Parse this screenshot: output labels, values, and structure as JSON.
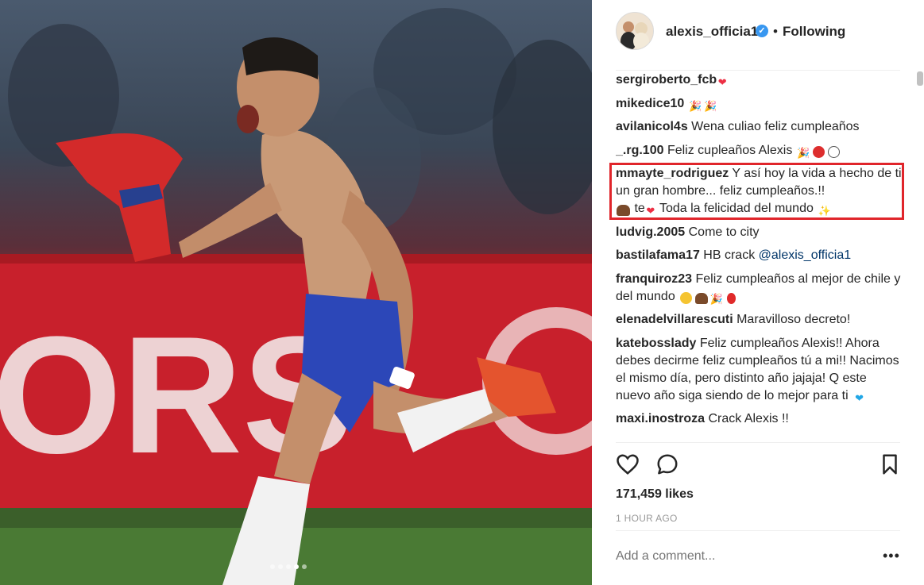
{
  "post": {
    "image_description_icon": "photo",
    "carousel": {
      "count": 5,
      "active_index": 3
    }
  },
  "header": {
    "username": "alexis_officia1",
    "verified_icon": "verified-badge-icon",
    "separator": "•",
    "follow_status": "Following"
  },
  "comments": [
    {
      "user": "sergiroberto_fcb",
      "text": "",
      "emoji": [
        "red-heart"
      ]
    },
    {
      "user": "mikedice10",
      "text": "",
      "emoji": [
        "party-popper",
        "party-popper"
      ]
    },
    {
      "user": "avilanicol4s",
      "text": "Wena culiao feliz cumpleaños",
      "emoji": []
    },
    {
      "user": "_.rg.100",
      "text": "Feliz cupleaños Alexis",
      "emoji": [
        "party-popper",
        "red-circle",
        "white-circle"
      ]
    },
    {
      "user": "mmayte_rodriguez",
      "text": "Y así hoy la vida a hecho de ti un gran hombre... feliz cumpleaños.!!",
      "text2": "te",
      "text3": "Toda la felicidad del mundo",
      "emoji": [
        "birthday-cake",
        "red-heart",
        "sparkles"
      ]
    },
    {
      "user": "ludvig.2005",
      "text": "Come to city",
      "emoji": []
    },
    {
      "user": "bastilafama17",
      "text": "HB crack",
      "mention": "@alexis_officia1",
      "emoji": []
    },
    {
      "user": "franquiroz23",
      "text": "Feliz cumpleaños al mejor de chile y del mundo",
      "emoji": [
        "grinning-face",
        "birthday-cake",
        "party-popper",
        "balloon"
      ]
    },
    {
      "user": "elenadelvillarescuti",
      "text": "Maravilloso decreto!",
      "emoji": []
    },
    {
      "user": "katebosslady",
      "text": "Feliz cumpleaños Alexis!! Ahora debes decirme feliz cumpleaños tú a mi!! Nacimos el mismo día, pero distinto año jajaja! Q este nuevo año siga siendo de lo mejor para ti",
      "emoji": [
        "blue-heart"
      ]
    },
    {
      "user": "maxi.inostroza",
      "text": "Crack Alexis !!",
      "emoji": []
    }
  ],
  "actions": {
    "like_icon": "heart-outline-icon",
    "comment_icon": "speech-bubble-icon",
    "save_icon": "bookmark-icon"
  },
  "likes": "171,459 likes",
  "timestamp": "1 HOUR AGO",
  "add_comment": {
    "placeholder": "Add a comment...",
    "more": "•••"
  },
  "colors": {
    "highlight_border": "#e0252b",
    "link": "#003569",
    "verified": "#3897f0"
  }
}
